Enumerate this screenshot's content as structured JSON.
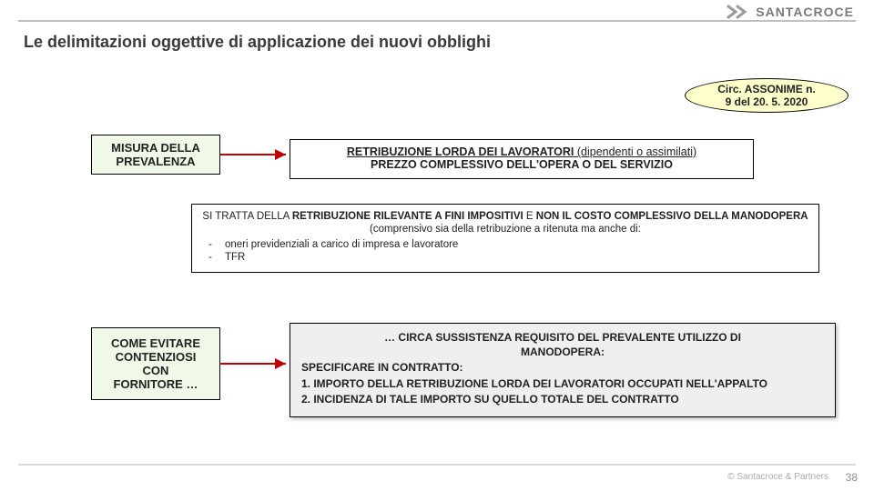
{
  "brand": {
    "name": "SANTACROCE"
  },
  "title": "Le delimitazioni oggettive di applicazione dei nuovi obblighi",
  "badge": {
    "line1": "Circ. ASSONIME n.",
    "line2": "9 del 20. 5. 2020"
  },
  "left_boxes": {
    "one_line1": "MISURA DELLA",
    "one_line2": "PREVALENZA",
    "two_line1": "COME EVITARE",
    "two_line2": "CONTENZIOSI",
    "two_line3": "CON",
    "two_line4": "FORNITORE …"
  },
  "formula": {
    "top_bold": "RETRIBUZIONE LORDA DEI LAVORATORI",
    "top_plain": " (dipendenti o assimilati)",
    "bottom": "PREZZO COMPLESSIVO DELL'OPERA O DEL SERVIZIO"
  },
  "detail": {
    "intro_pref": "SI TRATTA DELLA ",
    "intro_bold1": "RETRIBUZIONE RILEVANTE A FINI IMPOSITIVI",
    "intro_mid": " E ",
    "intro_bold2": "NON IL COSTO COMPLESSIVO DELLA MANODOPERA",
    "intro_suffix": " (comprensivo sia della retribuzione a ritenuta ma anche di:",
    "li1": "oneri previdenziali a carico di impresa e lavoratore",
    "li2": "TFR"
  },
  "gray": {
    "head1": "… CIRCA SUSSISTENZA REQUISITO DEL PREVALENTE UTILIZZO DI",
    "head2": "MANODOPERA:",
    "l1": "SPECIFICARE IN CONTRATTO:",
    "l2": "1. IMPORTO DELLA RETRIBUZIONE LORDA DEI LAVORATORI OCCUPATI NELL'APPALTO",
    "l3": "2. INCIDENZA DI TALE IMPORTO SU QUELLO TOTALE DEL CONTRATTO"
  },
  "footer": {
    "copy": "© Santacroce & Partners",
    "page": "38"
  }
}
